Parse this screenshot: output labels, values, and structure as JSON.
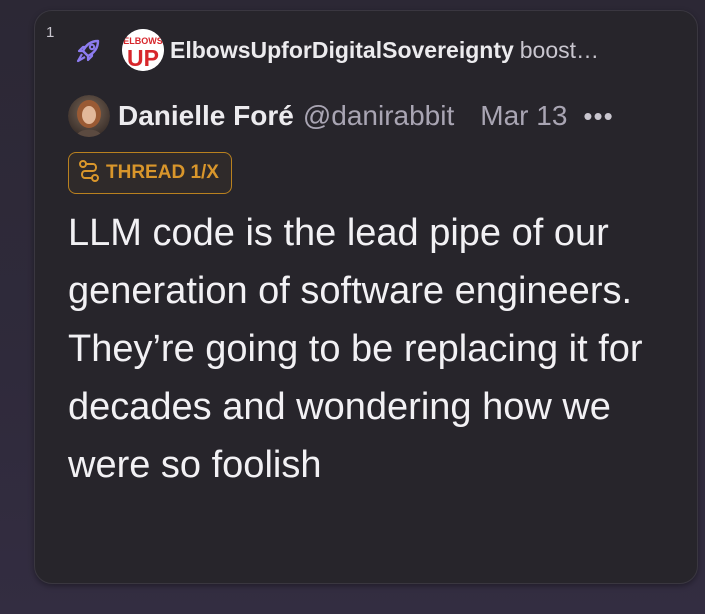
{
  "post": {
    "index": "1",
    "boost": {
      "booster_avatar_text": [
        "ELBOWS",
        "UP"
      ],
      "booster_name": "ElbowsUpforDigitalSovereignty",
      "verb": "boost…"
    },
    "author": {
      "name": "Danielle Foré",
      "handle": "@danirabbit",
      "date": "Mar 13"
    },
    "more_label": "•••",
    "thread_badge": "THREAD 1/X",
    "text": "LLM code is the lead pipe of our generation of software engineers. They’re going to be replacing it for decades and wondering how we were so foolish"
  },
  "colors": {
    "background": "#2c2835",
    "card": "#27252b",
    "accent_purple": "#8d7cf0",
    "thread_badge": "#d9962b",
    "booster_red": "#d7262b"
  },
  "icons": {
    "boost": "rocket-icon",
    "more": "more-dots-icon",
    "thread": "thread-icon"
  }
}
